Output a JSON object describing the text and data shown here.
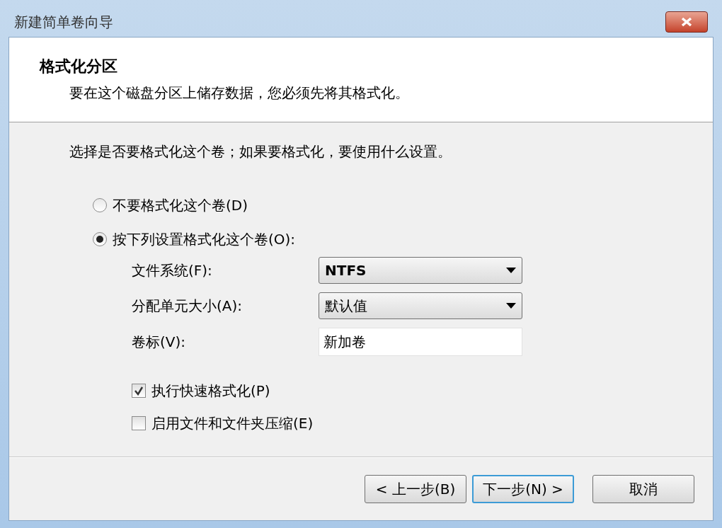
{
  "window": {
    "title": "新建简单卷向导"
  },
  "header": {
    "title": "格式化分区",
    "subtitle": "要在这个磁盘分区上储存数据，您必须先将其格式化。"
  },
  "prompt": "选择是否要格式化这个卷；如果要格式化，要使用什么设置。",
  "options": [
    {
      "label": "不要格式化这个卷(D)",
      "selected": false
    },
    {
      "label": "按下列设置格式化这个卷(O):",
      "selected": true
    }
  ],
  "settings": [
    {
      "kind": "dropdown",
      "label": "文件系统(F):",
      "value": "NTFS"
    },
    {
      "kind": "dropdown",
      "label": "分配单元大小(A):",
      "value": "默认值"
    },
    {
      "kind": "text",
      "label": "卷标(V):",
      "value": "新加卷"
    }
  ],
  "checkboxes": [
    {
      "label": "执行快速格式化(P)",
      "checked": true
    },
    {
      "label": "启用文件和文件夹压缩(E)",
      "checked": false
    }
  ],
  "buttons": [
    {
      "label": "< 上一步(B)",
      "kind": "normal"
    },
    {
      "label": "下一步(N) >",
      "kind": "default"
    },
    {
      "label": "取消",
      "kind": "normal"
    }
  ]
}
